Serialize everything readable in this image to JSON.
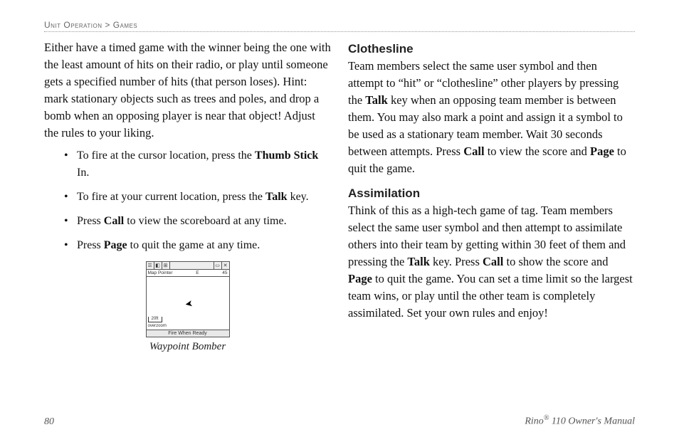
{
  "breadcrumb": {
    "part1": "Unit Operation",
    "sep": ">",
    "part2": "Games"
  },
  "left": {
    "intro_a": "Either have a timed game with the winner being the one with the least amount of hits on their radio, or play until someone gets a specified number of hits (that person loses). Hint: mark stationary objects such as trees and poles, and drop a bomb when an opposing player is near that object! Adjust the rules to your liking.",
    "bullets": {
      "b1_a": "To fire at the cursor location, press the ",
      "b1_bold": "Thumb Stick",
      "b1_b": " In.",
      "b2_a": "To fire at your current location, press the ",
      "b2_bold": "Talk",
      "b2_b": " key.",
      "b3_a": "Press ",
      "b3_bold": "Call",
      "b3_b": " to view the scoreboard at any time.",
      "b4_a": "Press ",
      "b4_bold": "Page",
      "b4_b": " to quit the game at any time."
    },
    "figure": {
      "caption": "Waypoint Bomber",
      "label_left": "Map Pointer",
      "label_e": "E",
      "label_num": "45",
      "scale": "20ft",
      "overzoom": "overzoom",
      "bottom": "Fire When Ready"
    }
  },
  "right": {
    "clothesline": {
      "heading": "Clothesline",
      "p_a": "Team members select the same user symbol and then attempt to “hit” or “clothesline” other players by pressing the ",
      "p_bold1": "Talk",
      "p_b": " key when an opposing team member is between them. You may also mark a point and assign it a symbol to be used as a stationary team member. Wait 30 seconds between attempts. Press ",
      "p_bold2": "Call",
      "p_c": " to view the score and ",
      "p_bold3": "Page",
      "p_d": " to quit the game."
    },
    "assimilation": {
      "heading": "Assimilation",
      "p_a": "Think of this as a high-tech game of tag. Team members select the same user symbol and then attempt to assimilate others into their team by getting within 30 feet of them and pressing the ",
      "p_bold1": "Talk",
      "p_b": " key. Press ",
      "p_bold2": "Call",
      "p_c": " to show the score and ",
      "p_bold3": "Page",
      "p_d": " to quit the game. You can set a time limit so the largest team wins, or play until the other team is completely assimilated. Set your own rules and enjoy!"
    }
  },
  "footer": {
    "pageno": "80",
    "brand": "Rino",
    "reg": "®",
    "rest": " 110 Owner's Manual"
  }
}
